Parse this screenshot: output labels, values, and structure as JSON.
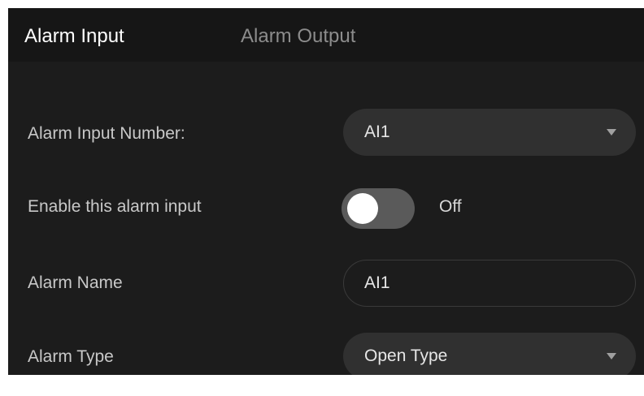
{
  "tabs": {
    "alarm_input": "Alarm Input",
    "alarm_output": "Alarm Output"
  },
  "form": {
    "alarm_input_number_label": "Alarm Input Number:",
    "alarm_input_number_value": "AI1",
    "enable_label": "Enable this alarm input",
    "enable_state": "Off",
    "alarm_name_label": "Alarm Name",
    "alarm_name_value": "AI1",
    "alarm_type_label": "Alarm Type",
    "alarm_type_value": "Open Type"
  },
  "icons": {
    "dropdown": "chevron-down-icon"
  }
}
